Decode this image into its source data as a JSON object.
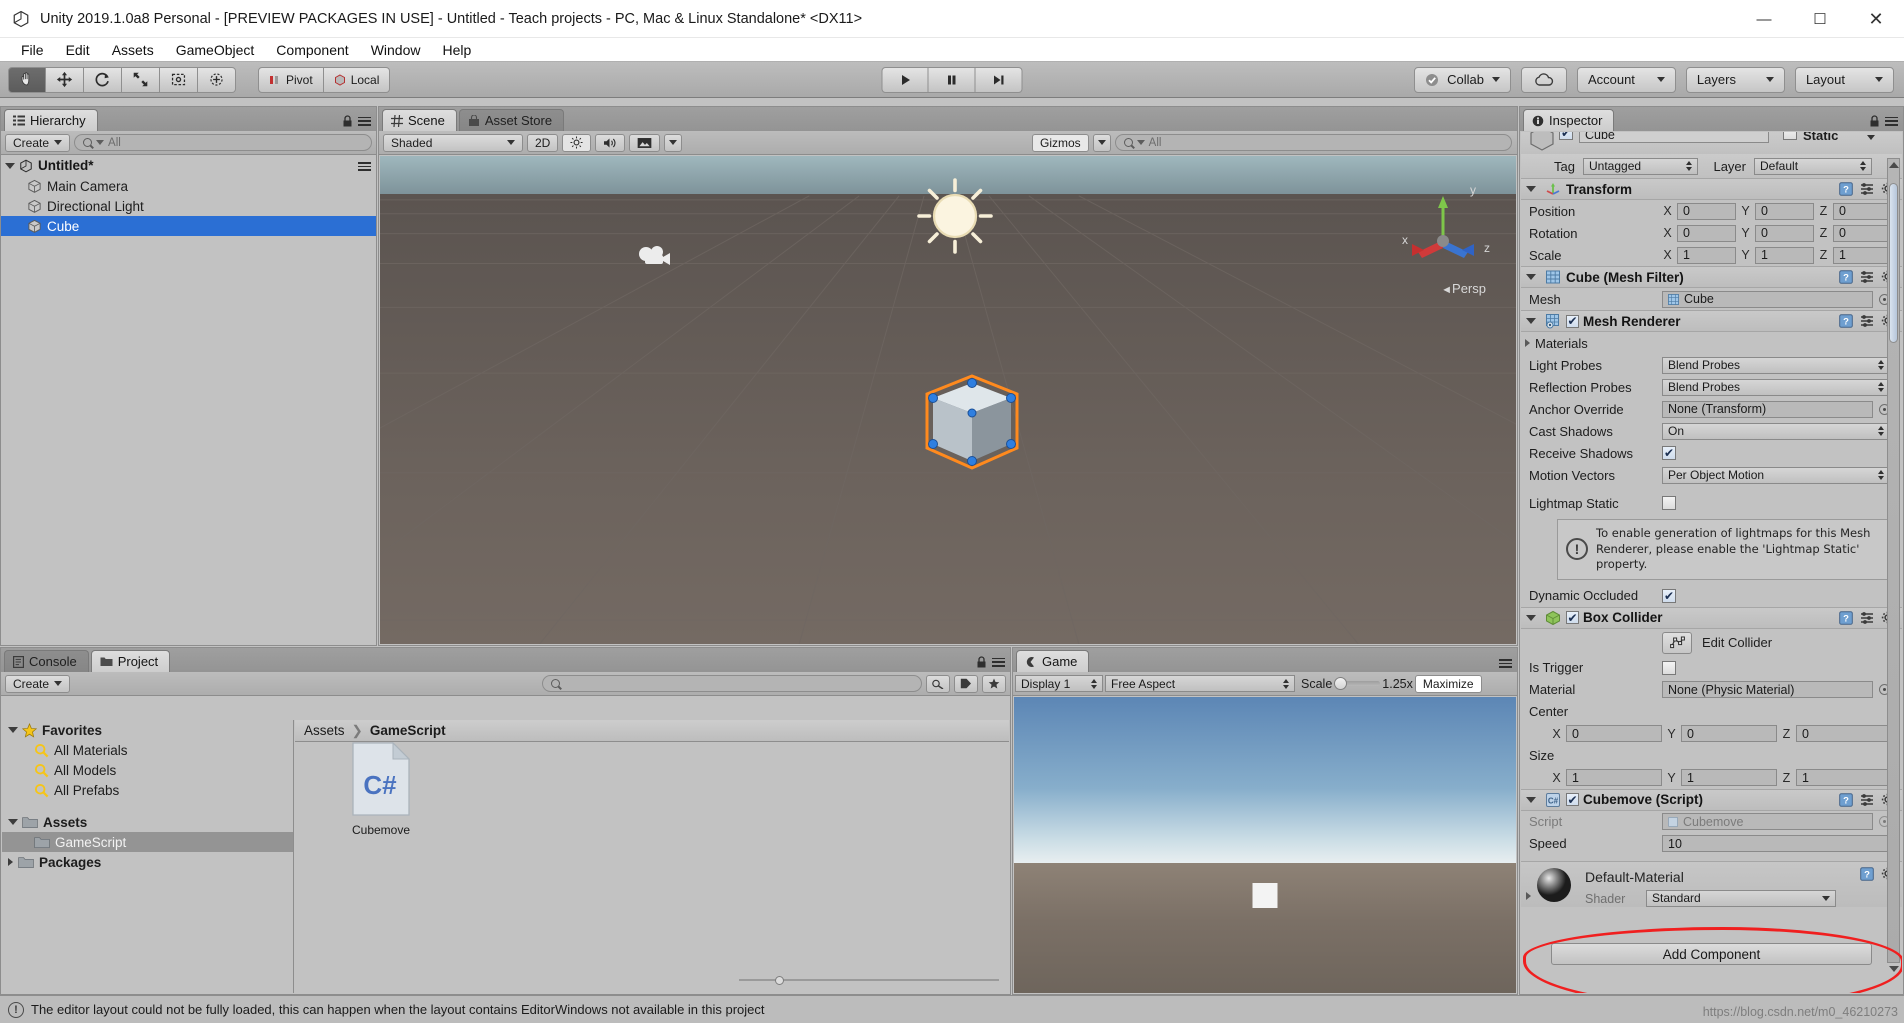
{
  "window": {
    "title": "Unity 2019.1.0a8 Personal - [PREVIEW PACKAGES IN USE] - Untitled - Teach projects - PC, Mac & Linux Standalone* <DX11>",
    "minimize": "—",
    "maximize": "☐",
    "close": "✕"
  },
  "menu": {
    "items": [
      "File",
      "Edit",
      "Assets",
      "GameObject",
      "Component",
      "Window",
      "Help"
    ]
  },
  "toolbar": {
    "tools": [
      "hand-tool",
      "move-tool",
      "rotate-tool",
      "scale-tool",
      "rect-tool",
      "transform-tool"
    ],
    "pivot": "Pivot",
    "local": "Local",
    "play": "play-icon",
    "pause": "pause-icon",
    "step": "step-icon",
    "collab": "Collab",
    "cloud": "cloud-icon",
    "account": "Account",
    "layers": "Layers",
    "layout": "Layout"
  },
  "hierarchy": {
    "tab": "Hierarchy",
    "create": "Create",
    "search_placeholder": "All",
    "scene_name": "Untitled*",
    "items": [
      {
        "label": "Main Camera",
        "selected": false
      },
      {
        "label": "Directional Light",
        "selected": false
      },
      {
        "label": "Cube",
        "selected": true
      }
    ]
  },
  "scene": {
    "tabs": [
      {
        "label": "Scene",
        "selected": true,
        "icon": "grid-icon"
      },
      {
        "label": "Asset Store",
        "selected": false,
        "icon": "store-icon"
      }
    ],
    "shading": "Shaded",
    "mode2d": "2D",
    "lighting": "light-icon",
    "audio": "audio-icon",
    "effects": "image-icon",
    "gizmos": "Gizmos",
    "search_placeholder": "All",
    "perspective_label": "Persp",
    "axis": {
      "x": "x",
      "y": "y",
      "z": "z"
    }
  },
  "project": {
    "tabs": [
      {
        "label": "Console",
        "selected": false,
        "icon": "console-icon"
      },
      {
        "label": "Project",
        "selected": true,
        "icon": "folder-icon"
      }
    ],
    "create": "Create",
    "search_placeholder": "",
    "breadcrumb": [
      "Assets",
      "GameScript"
    ],
    "tree": [
      {
        "label": "Favorites",
        "icon": "star-icon",
        "depth": 0,
        "bold": true,
        "expanded": true
      },
      {
        "label": "All Materials",
        "icon": "search-icon",
        "depth": 1,
        "bold": false
      },
      {
        "label": "All Models",
        "icon": "search-icon",
        "depth": 1,
        "bold": false
      },
      {
        "label": "All Prefabs",
        "icon": "search-icon",
        "depth": 1,
        "bold": false
      },
      {
        "label": "Assets",
        "icon": "folder-icon",
        "depth": 0,
        "bold": true,
        "expanded": true
      },
      {
        "label": "GameScript",
        "icon": "folder-icon",
        "depth": 1,
        "bold": false,
        "selected": true
      },
      {
        "label": "Packages",
        "icon": "folder-icon",
        "depth": 0,
        "bold": true,
        "expanded": false
      }
    ],
    "assets": [
      {
        "label": "Cubemove",
        "type": "C#"
      }
    ]
  },
  "game": {
    "tab": "Game",
    "display": "Display 1",
    "aspect": "Free Aspect",
    "scale_label": "Scale",
    "scale_value": "1.25x",
    "maximize": "Maximize"
  },
  "inspector": {
    "tab": "Inspector",
    "object_name": "Cube",
    "static_label": "Static",
    "tag_label": "Tag",
    "tag_value": "Untagged",
    "layer_label": "Layer",
    "layer_value": "Default",
    "transform": {
      "title": "Transform",
      "rows": [
        {
          "label": "Position",
          "x": "0",
          "y": "0",
          "z": "0"
        },
        {
          "label": "Rotation",
          "x": "0",
          "y": "0",
          "z": "0"
        },
        {
          "label": "Scale",
          "x": "1",
          "y": "1",
          "z": "1"
        }
      ]
    },
    "mesh_filter": {
      "title": "Cube (Mesh Filter)",
      "mesh_label": "Mesh",
      "mesh_value": "Cube"
    },
    "mesh_renderer": {
      "title": "Mesh Renderer",
      "materials_label": "Materials",
      "light_probes_label": "Light Probes",
      "light_probes_value": "Blend Probes",
      "reflection_probes_label": "Reflection Probes",
      "reflection_probes_value": "Blend Probes",
      "anchor_override_label": "Anchor Override",
      "anchor_override_value": "None (Transform)",
      "cast_shadows_label": "Cast Shadows",
      "cast_shadows_value": "On",
      "receive_shadows_label": "Receive Shadows",
      "motion_vectors_label": "Motion Vectors",
      "motion_vectors_value": "Per Object Motion",
      "lightmap_static_label": "Lightmap Static",
      "help_text": "To enable generation of lightmaps for this Mesh Renderer, please enable the 'Lightmap Static' property.",
      "dynamic_occluded_label": "Dynamic Occluded"
    },
    "box_collider": {
      "title": "Box Collider",
      "edit_collider": "Edit Collider",
      "is_trigger_label": "Is Trigger",
      "material_label": "Material",
      "material_value": "None (Physic Material)",
      "center_label": "Center",
      "center": {
        "x": "0",
        "y": "0",
        "z": "0"
      },
      "size_label": "Size",
      "size": {
        "x": "1",
        "y": "1",
        "z": "1"
      }
    },
    "script_component": {
      "title": "Cubemove (Script)",
      "script_label": "Script",
      "script_value": "Cubemove",
      "speed_label": "Speed",
      "speed_value": "10",
      "highlight_color": "#f01f1f"
    },
    "material": {
      "title": "Default-Material",
      "shader_label": "Shader",
      "shader_value": "Standard"
    },
    "add_component": "Add Component"
  },
  "status": {
    "message": "The editor layout could not be fully loaded, this can happen when the layout contains EditorWindows not available in this project",
    "watermark": "https://blog.csdn.net/m0_46210273"
  }
}
